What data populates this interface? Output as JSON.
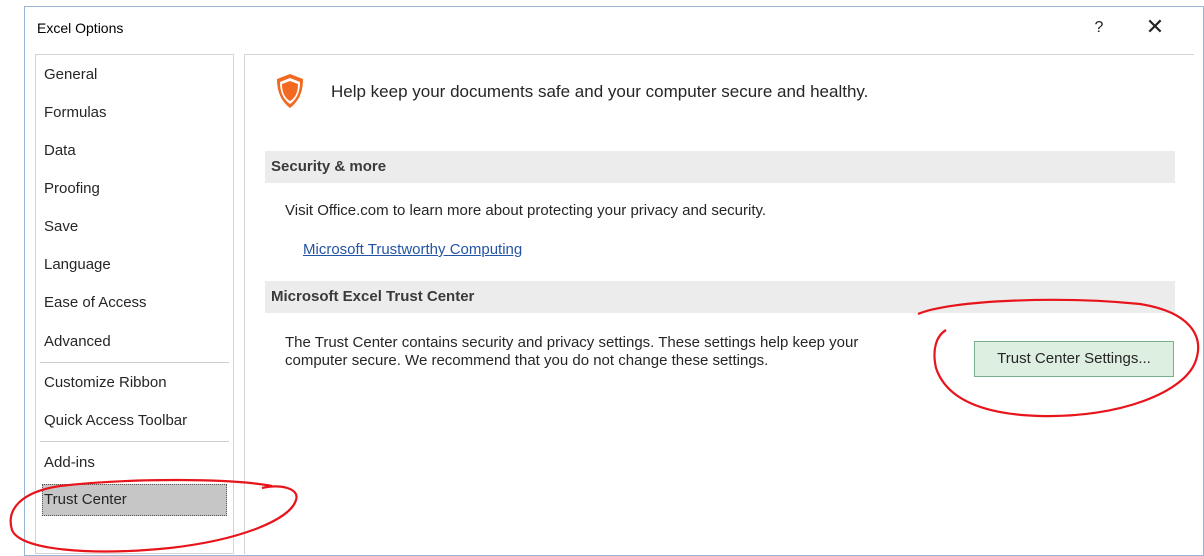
{
  "dialog": {
    "title": "Excel Options",
    "help_label": "?",
    "close_label": "✕"
  },
  "sidebar": {
    "items": [
      {
        "label": "General"
      },
      {
        "label": "Formulas"
      },
      {
        "label": "Data"
      },
      {
        "label": "Proofing"
      },
      {
        "label": "Save"
      },
      {
        "label": "Language"
      },
      {
        "label": "Ease of Access"
      },
      {
        "label": "Advanced"
      },
      {
        "label": "Customize Ribbon"
      },
      {
        "label": "Quick Access Toolbar"
      },
      {
        "label": "Add-ins"
      },
      {
        "label": "Trust Center",
        "selected": true
      }
    ]
  },
  "content": {
    "intro": "Help keep your documents safe and your computer secure and healthy.",
    "security": {
      "heading": "Security & more",
      "text": "Visit Office.com to learn more about protecting your privacy and security.",
      "link": "Microsoft Trustworthy Computing"
    },
    "trust_center": {
      "heading": "Microsoft Excel Trust Center",
      "text_line1": "The Trust Center contains security and privacy settings. These settings help keep your",
      "text_line2": "computer secure. We recommend that you do not change these settings.",
      "button_label": "Trust Center Settings..."
    }
  },
  "colors": {
    "shield": "#f26a21",
    "selected_bg": "#c6c6c6",
    "button_bg": "#dcefe1",
    "link": "#2455a4",
    "annotation": "#e8141b"
  },
  "icons": {
    "intro": "shield-icon",
    "help": "question-mark-icon",
    "close": "close-icon"
  }
}
